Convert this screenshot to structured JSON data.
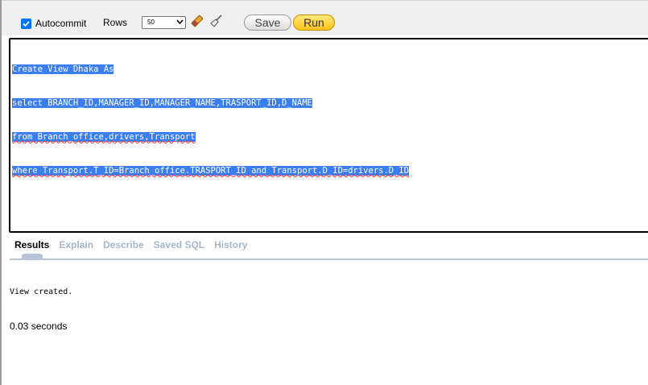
{
  "toolbar": {
    "autocommit_label": "Autocommit",
    "autocommit_checked": true,
    "rows_label": "Rows",
    "rows_value": "50",
    "save_label": "Save",
    "run_label": "Run",
    "clear_icon": "eraser-icon",
    "format_icon": "broom-icon"
  },
  "editor": {
    "lines": [
      "Create View Dhaka As",
      "select BRANCH_ID,MANAGER_ID,MANAGER_NAME,TRASPORT_ID,D_NAME",
      "from Branch_office,drivers,Transport",
      "where Transport.T_ID=Branch_office.TRASPORT_ID and Transport.D_ID=drivers.D_ID"
    ],
    "selection_color": "#3a7ef0"
  },
  "tabs": [
    {
      "label": "Results",
      "active": true
    },
    {
      "label": "Explain",
      "active": false
    },
    {
      "label": "Describe",
      "active": false
    },
    {
      "label": "Saved SQL",
      "active": false
    },
    {
      "label": "History",
      "active": false
    }
  ],
  "results": {
    "message": "View created.",
    "elapsed": "0.03 seconds"
  },
  "colors": {
    "run_button": "#ffc31a",
    "tab_inactive": "#a8b4c8"
  }
}
